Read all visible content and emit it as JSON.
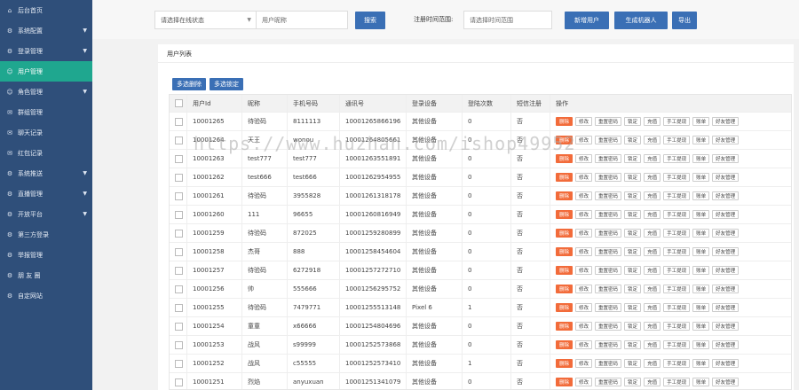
{
  "sidebar": {
    "items": [
      {
        "icon": "home-icon",
        "glyph": "⌂",
        "label": "后台首页",
        "chevron": false,
        "active": false
      },
      {
        "icon": "gear-icon",
        "glyph": "⚙",
        "label": "系统配置",
        "chevron": true,
        "active": false
      },
      {
        "icon": "gear-icon",
        "glyph": "⚙",
        "label": "登录管理",
        "chevron": true,
        "active": false
      },
      {
        "icon": "user-icon",
        "glyph": "☺",
        "label": "用户管理",
        "chevron": false,
        "active": true
      },
      {
        "icon": "role-icon",
        "glyph": "☺",
        "label": "角色管理",
        "chevron": true,
        "active": false
      },
      {
        "icon": "message-icon",
        "glyph": "✉",
        "label": "群组管理",
        "chevron": false,
        "active": false
      },
      {
        "icon": "chat-icon",
        "glyph": "✉",
        "label": "聊天记录",
        "chevron": false,
        "active": false
      },
      {
        "icon": "redpacket-icon",
        "glyph": "✉",
        "label": "红包记录",
        "chevron": false,
        "active": false
      },
      {
        "icon": "system-icon",
        "glyph": "⚙",
        "label": "系统推送",
        "chevron": true,
        "active": false
      },
      {
        "icon": "live-icon",
        "glyph": "⚙",
        "label": "直播管理",
        "chevron": true,
        "active": false
      },
      {
        "icon": "open-icon",
        "glyph": "⚙",
        "label": "开放平台",
        "chevron": true,
        "active": false
      },
      {
        "icon": "third-party-icon",
        "glyph": "⚙",
        "label": "第三方登录",
        "chevron": false,
        "active": false
      },
      {
        "icon": "report-icon",
        "glyph": "⚙",
        "label": "举报管理",
        "chevron": false,
        "active": false
      },
      {
        "icon": "moments-icon",
        "glyph": "⚙",
        "label": "朋 友 圈",
        "chevron": false,
        "active": false
      },
      {
        "icon": "website-icon",
        "glyph": "⚙",
        "label": "自定网站",
        "chevron": false,
        "active": false
      }
    ]
  },
  "filter": {
    "status_select": "请选择在线状态",
    "nickname_placeholder": "用户昵称",
    "search_label": "搜索",
    "reg_time_label": "注册时间范围:",
    "date_placeholder": "请选择时间范围",
    "add_user_label": "新增用户",
    "gen_robot_label": "生成机器人",
    "export_label": "导出"
  },
  "panel": {
    "title": "用户列表",
    "batch_delete_label": "多选删除",
    "batch_lock_label": "多选锁定"
  },
  "table": {
    "headers": [
      "用户Id",
      "昵称",
      "手机号码",
      "通讯号",
      "登录设备",
      "登陆次数",
      "短信注册",
      "操作"
    ],
    "actions": [
      "删除",
      "修改",
      "重置密码",
      "锁定",
      "充值",
      "手工提现",
      "账单",
      "好友管理"
    ],
    "rows": [
      [
        "10001265",
        "待验码",
        "8111113",
        "10001265866196",
        "其他设备",
        "0",
        "否"
      ],
      [
        "10001264",
        "天王",
        "wonou",
        "10001264805661",
        "其他设备",
        "0",
        "否"
      ],
      [
        "10001263",
        "test777",
        "test777",
        "10001263551891",
        "其他设备",
        "0",
        "否"
      ],
      [
        "10001262",
        "test666",
        "test666",
        "10001262954955",
        "其他设备",
        "0",
        "否"
      ],
      [
        "10001261",
        "待验码",
        "3955828",
        "10001261318178",
        "其他设备",
        "0",
        "否"
      ],
      [
        "10001260",
        "111",
        "96655",
        "10001260816949",
        "其他设备",
        "0",
        "否"
      ],
      [
        "10001259",
        "待验码",
        "872025",
        "10001259280899",
        "其他设备",
        "0",
        "否"
      ],
      [
        "10001258",
        "杰哥",
        "888",
        "10001258454604",
        "其他设备",
        "0",
        "否"
      ],
      [
        "10001257",
        "待验码",
        "6272918",
        "10001257272710",
        "其他设备",
        "0",
        "否"
      ],
      [
        "10001256",
        "帅",
        "555666",
        "10001256295752",
        "其他设备",
        "0",
        "否"
      ],
      [
        "10001255",
        "待验码",
        "7479771",
        "10001255513148",
        "Pixel 6",
        "1",
        "否"
      ],
      [
        "10001254",
        "童童",
        "x66666",
        "10001254804696",
        "其他设备",
        "0",
        "否"
      ],
      [
        "10001253",
        "战风",
        "s99999",
        "10001252573868",
        "其他设备",
        "0",
        "否"
      ],
      [
        "10001252",
        "战风",
        "c55555",
        "10001252573410",
        "其他设备",
        "1",
        "否"
      ],
      [
        "10001251",
        "烈焰",
        "anyuxuan",
        "10001251341079",
        "其他设备",
        "0",
        "否"
      ]
    ]
  },
  "watermark": "https://www.huzhan.com/ishop49952"
}
